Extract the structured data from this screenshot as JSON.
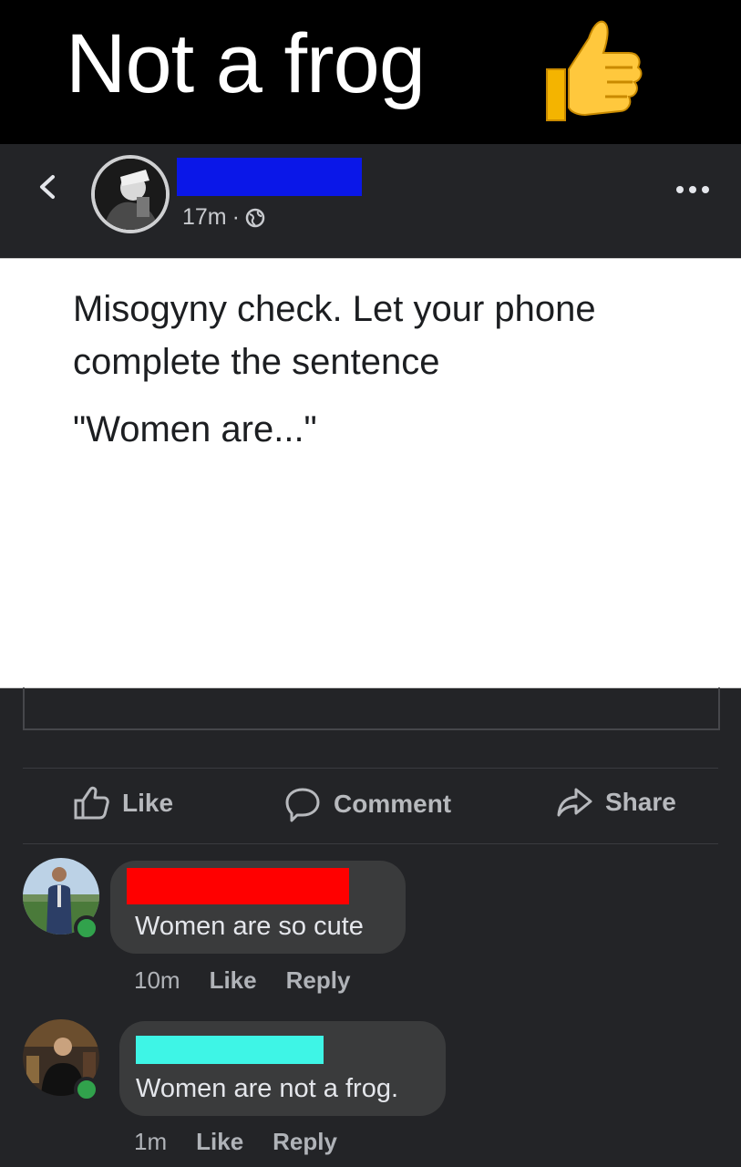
{
  "banner": {
    "title": "Not a frog",
    "emoji_icon": "thumbs-up-icon"
  },
  "post": {
    "time": "17m",
    "separator": "·",
    "privacy_icon": "globe-icon",
    "text": "Misogyny check. Let your phone complete the sentence",
    "quote": "\"Women are...\"",
    "author_redaction_color": "#0a17e8"
  },
  "actions": {
    "like_label": "Like",
    "comment_label": "Comment",
    "share_label": "Share"
  },
  "comments": [
    {
      "redaction_color": "#ff0000",
      "text": "Women are so cute",
      "time": "10m",
      "like_label": "Like",
      "reply_label": "Reply"
    },
    {
      "redaction_color": "#3ef5e6",
      "text": "Women are not a frog.",
      "time": "1m",
      "like_label": "Like",
      "reply_label": "Reply"
    }
  ],
  "colors": {
    "background": "#232427",
    "bubble": "#3a3b3c",
    "online": "#31a24c"
  }
}
